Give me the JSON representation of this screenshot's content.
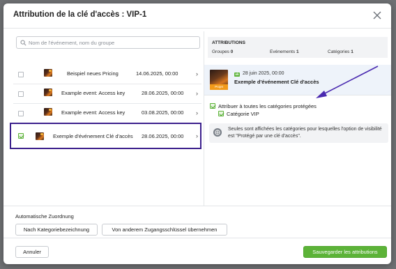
{
  "dialog": {
    "title": "Attribution de la clé d'accès : VIP-1"
  },
  "search": {
    "placeholder": "Nom de l'événement, nom du groupe",
    "value": ""
  },
  "events": [
    {
      "name": "Beispiel neues Pricing",
      "date": "14.06.2025, 00:00",
      "checked": false
    },
    {
      "name": "Example event: Access key",
      "date": "28.06.2025, 00:00",
      "checked": false
    },
    {
      "name": "Example event: Access key",
      "date": "03.08.2025, 00:00",
      "checked": false
    },
    {
      "name": "Exemple d'événement Clé d'accès",
      "date": "28.06.2025, 00:00",
      "checked": true
    }
  ],
  "attributions": {
    "title": "ATTRIBUTIONS",
    "groups_label": "Groupes",
    "groups_count": "0",
    "events_label": "Evénements",
    "events_count": "1",
    "categories_label": "Catégories",
    "categories_count": "1"
  },
  "selected_event": {
    "ok_badge": "ok",
    "date": "28 juin 2025, 00:00",
    "name": "Exemple d'événement Clé d'accès",
    "image_badge": "Projet"
  },
  "categories": {
    "assign_all_label": "Attribuer à toutes les catégories protégées",
    "assign_all_checked": true,
    "items": [
      {
        "label": "Catégorie VIP",
        "checked": true
      }
    ]
  },
  "info": {
    "text": "Seules sont affichées les catégories pour lesquelles l'option de visibilité est \"Protégé par une clé d'accès\"."
  },
  "auto_assign": {
    "label": "Automatische Zuordnung",
    "by_category_button": "Nach Kategoriebezeichnung",
    "from_other_key_button": "Von anderem Zugangsschlüssel übernehmen"
  },
  "footer": {
    "cancel_button": "Annuler",
    "save_button": "Sauvegarder les attributions"
  },
  "colors": {
    "primary_green": "#5cb338",
    "highlight_outline": "#3b1f8c",
    "annotation_arrow": "#4a2ab0"
  }
}
